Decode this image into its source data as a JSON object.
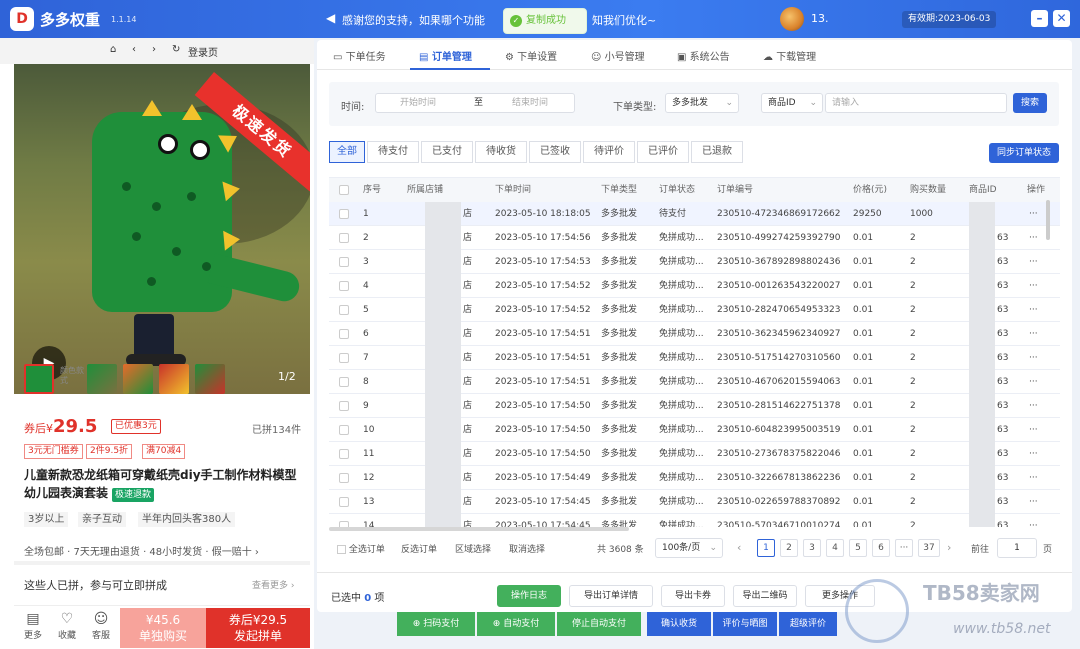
{
  "titlebar": {
    "logo_glyph": "D",
    "app_name": "多多权重",
    "version": "1.1.14",
    "notice": "感谢您的支持，如果哪个功能",
    "notice_tail": "知我们优化~",
    "toast": "复制成功",
    "user": "13.",
    "expire": "有效期:2023-06-03",
    "min": "–",
    "close": "✕"
  },
  "browser": {
    "home": "⌂",
    "back": "‹",
    "forward": "›",
    "refresh": "↻",
    "login": "登录页"
  },
  "product": {
    "ribbon": "极速发货",
    "play_icon": "▶",
    "pager": "1/2",
    "thumb_label": "颜色款式",
    "price_prefix": "券后¥",
    "price": "29.5",
    "coupon": "已优惠3元",
    "sold": "已拼134件",
    "tags": [
      "3元无门槛券",
      "2件9.5折",
      "满70减4"
    ],
    "title": "儿童新款恐龙纸箱可穿戴纸壳diy手工制作材料模型幼儿园表演套装",
    "badge": "极速退款",
    "feature_tags": [
      "3岁以上",
      "亲子互动",
      "半年内回头客380人"
    ],
    "services": "全场包邮 · 7天无理由退货 · 48小时发货 · 假一赔十 ›",
    "join": "这些人已拼，参与可立即拼成",
    "view_more": "查看更多 ›",
    "bottom": [
      {
        "icon": "▤",
        "label": "更多"
      },
      {
        "icon": "♡",
        "label": "收藏"
      },
      {
        "icon": "☺",
        "label": "客服"
      }
    ],
    "buy_single_price": "¥45.6",
    "buy_single_label": "单独购买",
    "buy_group_price": "券后¥29.5",
    "buy_group_label": "发起拼单"
  },
  "tabs": [
    {
      "icon": "▭",
      "label": "下单任务"
    },
    {
      "icon": "▤",
      "label": "订单管理"
    },
    {
      "icon": "⚙",
      "label": "下单设置"
    },
    {
      "icon": "☺",
      "label": "小号管理"
    },
    {
      "icon": "▣",
      "label": "系统公告"
    },
    {
      "icon": "☁",
      "label": "下载管理"
    }
  ],
  "filter": {
    "time_label": "时间:",
    "start_placeholder": "开始时间",
    "to": "至",
    "end_placeholder": "结束时间",
    "type_label": "下单类型:",
    "type_value": "多多批发",
    "id_select": "商品ID",
    "id_placeholder": "请输入",
    "search": "搜索"
  },
  "status_tabs": [
    "全部",
    "待支付",
    "已支付",
    "待收货",
    "已签收",
    "待评价",
    "已评价",
    "已退款"
  ],
  "sync_button": "同步订单状态",
  "table": {
    "headers": [
      "序号",
      "所属店铺",
      "下单时间",
      "下单类型",
      "订单状态",
      "订单编号",
      "价格(元)",
      "购买数量",
      "商品ID",
      "操作"
    ],
    "rows": [
      {
        "no": "1",
        "shop": "店",
        "time": "2023-05-10 18:18:05",
        "type": "多多批发",
        "status": "待支付",
        "order": "230510-472346869172662",
        "price": "29250",
        "qty": "1000",
        "pid": "",
        "op": "···"
      },
      {
        "no": "2",
        "shop": "店",
        "time": "2023-05-10 17:54:56",
        "type": "多多批发",
        "status": "免拼成功...",
        "order": "230510-499274259392790",
        "price": "0.01",
        "qty": "2",
        "pid": "63",
        "op": "···"
      },
      {
        "no": "3",
        "shop": "店",
        "time": "2023-05-10 17:54:53",
        "type": "多多批发",
        "status": "免拼成功...",
        "order": "230510-367892898802436",
        "price": "0.01",
        "qty": "2",
        "pid": "63",
        "op": "···"
      },
      {
        "no": "4",
        "shop": "店",
        "time": "2023-05-10 17:54:52",
        "type": "多多批发",
        "status": "免拼成功...",
        "order": "230510-001263543220027",
        "price": "0.01",
        "qty": "2",
        "pid": "63",
        "op": "···"
      },
      {
        "no": "5",
        "shop": "店",
        "time": "2023-05-10 17:54:52",
        "type": "多多批发",
        "status": "免拼成功...",
        "order": "230510-282470654953323",
        "price": "0.01",
        "qty": "2",
        "pid": "63",
        "op": "···"
      },
      {
        "no": "6",
        "shop": "店",
        "time": "2023-05-10 17:54:51",
        "type": "多多批发",
        "status": "免拼成功...",
        "order": "230510-362345962340927",
        "price": "0.01",
        "qty": "2",
        "pid": "63",
        "op": "···"
      },
      {
        "no": "7",
        "shop": "店",
        "time": "2023-05-10 17:54:51",
        "type": "多多批发",
        "status": "免拼成功...",
        "order": "230510-517514270310560",
        "price": "0.01",
        "qty": "2",
        "pid": "63",
        "op": "···"
      },
      {
        "no": "8",
        "shop": "店",
        "time": "2023-05-10 17:54:51",
        "type": "多多批发",
        "status": "免拼成功...",
        "order": "230510-467062015594063",
        "price": "0.01",
        "qty": "2",
        "pid": "63",
        "op": "···"
      },
      {
        "no": "9",
        "shop": "店",
        "time": "2023-05-10 17:54:50",
        "type": "多多批发",
        "status": "免拼成功...",
        "order": "230510-281514622751378",
        "price": "0.01",
        "qty": "2",
        "pid": "63",
        "op": "···"
      },
      {
        "no": "10",
        "shop": "店",
        "time": "2023-05-10 17:54:50",
        "type": "多多批发",
        "status": "免拼成功...",
        "order": "230510-604823995003519",
        "price": "0.01",
        "qty": "2",
        "pid": "63",
        "op": "···"
      },
      {
        "no": "11",
        "shop": "店",
        "time": "2023-05-10 17:54:50",
        "type": "多多批发",
        "status": "免拼成功...",
        "order": "230510-273678375822046",
        "price": "0.01",
        "qty": "2",
        "pid": "63",
        "op": "···"
      },
      {
        "no": "12",
        "shop": "店",
        "time": "2023-05-10 17:54:49",
        "type": "多多批发",
        "status": "免拼成功...",
        "order": "230510-322667813862236",
        "price": "0.01",
        "qty": "2",
        "pid": "63",
        "op": "···"
      },
      {
        "no": "13",
        "shop": "店",
        "time": "2023-05-10 17:54:45",
        "type": "多多批发",
        "status": "免拼成功...",
        "order": "230510-022659788370892",
        "price": "0.01",
        "qty": "2",
        "pid": "63",
        "op": "···"
      },
      {
        "no": "14",
        "shop": "店",
        "time": "2023-05-10 17:54:45",
        "type": "多多批发",
        "status": "免拼成功...",
        "order": "230510-570346710010274",
        "price": "0.01",
        "qty": "2",
        "pid": "63",
        "op": "···"
      }
    ]
  },
  "pagination": {
    "select_page": "全选订单",
    "invert": "反选订单",
    "range": "区域选择",
    "cancel": "取消选择",
    "total": "共 3608 条",
    "per_page": "100条/页",
    "pages": [
      "1",
      "2",
      "3",
      "4",
      "5",
      "6",
      "···",
      "37"
    ],
    "prev": "‹",
    "next": "›",
    "goto": "前往",
    "goto_value": "1",
    "page_unit": "页"
  },
  "footer": {
    "selected_prefix": "已选中",
    "selected_count": "0",
    "selected_suffix": "项",
    "log": "操作日志",
    "export_detail": "导出订单详情",
    "export_card": "导出卡券",
    "btn4": "导出二维码",
    "btn5": "更多操作"
  },
  "actions": {
    "scan_pay": "⊕ 扫码支付",
    "auto_pay": "⊕ 自动支付",
    "stop_auto": "停止自动支付",
    "confirm": "确认收货",
    "review": "评价与晒图",
    "super": "超级评价"
  },
  "watermark": {
    "text": "TB58卖家网",
    "url": "www.tb58.net"
  },
  "colors": {
    "brand": "#2f63d8",
    "success": "#43b05c",
    "price": "#e0322a"
  }
}
